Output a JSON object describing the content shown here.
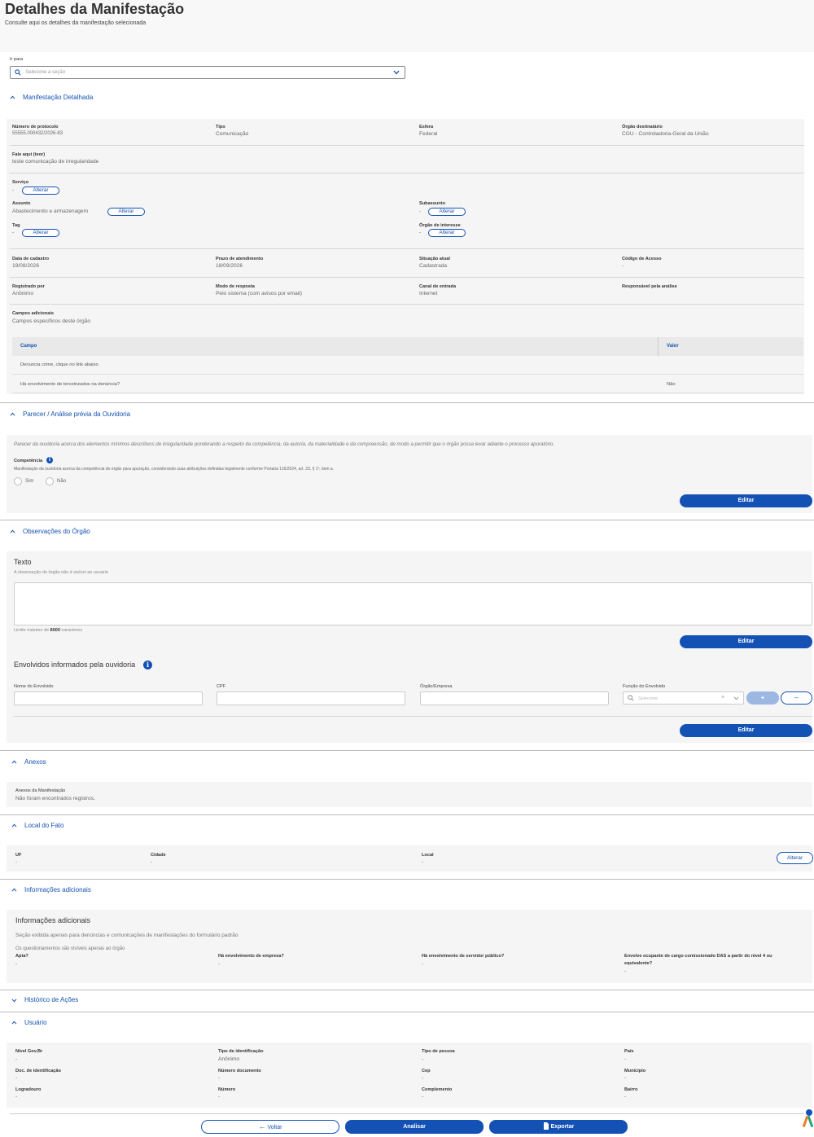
{
  "header": {
    "title": "Detalhes da Manifestação",
    "subtitle": "Consulte aqui os detalhes da manifestação selecionada"
  },
  "goto": {
    "label": "Ir para",
    "placeholder": "Selecione a seção"
  },
  "manifestacao": {
    "title": "Manifestação Detalhada",
    "protocolo": {
      "label": "Número de protocolo",
      "value": "55555.000432/2026-83"
    },
    "tipo": {
      "label": "Tipo",
      "value": "Comunicação"
    },
    "esfera": {
      "label": "Esfera",
      "value": "Federal"
    },
    "orgao_destinatario": {
      "label": "Órgão destinatário",
      "value": "CGU - Controladoria-Geral da União"
    },
    "teor": {
      "label": "Fale aqui (teor)",
      "value": "teste comunicação de irregularidade"
    },
    "servico": {
      "label": "Serviço",
      "value": "-"
    },
    "assunto": {
      "label": "Assunto",
      "value": "Abastecimento e armazenagem"
    },
    "subassunto": {
      "label": "Subassunto",
      "value": "-"
    },
    "tag": {
      "label": "Tag",
      "value": "-"
    },
    "orgao_interesse": {
      "label": "Órgão de interesse",
      "value": "-"
    },
    "alterar_label": "Alterar",
    "data_cadastro": {
      "label": "Data de cadastro",
      "value": "19/08/2026"
    },
    "prazo": {
      "label": "Prazo de atendimento",
      "value": "18/09/2026"
    },
    "situacao": {
      "label": "Situação atual",
      "value": "Cadastrada"
    },
    "codigo_acesso": {
      "label": "Código de Acesso",
      "value": "-"
    },
    "registrado_por": {
      "label": "Registrado por",
      "value": "Anônimo"
    },
    "modo_resposta": {
      "label": "Modo de resposta",
      "value": "Pelo sistema (com avisos por email)"
    },
    "canal_entrada": {
      "label": "Canal de entrada",
      "value": "Internet"
    },
    "responsavel": {
      "label": "Responsável pela análise"
    },
    "campos_adicionais": {
      "label": "Campos adicionais",
      "value": "Campos específicos deste órgão"
    },
    "table": {
      "headers": [
        "Campo",
        "Valor"
      ],
      "rows": [
        [
          "Denuncia crime, clique no link abaixo",
          ""
        ],
        [
          "Há envolvimento de terceirizados na denúncia?",
          "Não"
        ]
      ]
    }
  },
  "parecer": {
    "title": "Parecer / Análise prévia da Ouvidoria",
    "description": "Parecer da ouvidoria acerca dos elementos mínimos descritivos de irregularidade ponderando a respeito da competência, da autoria, da materialidade e da compreensão, de modo a permitir que o órgão possa levar adiante o processo apuratório.",
    "competencia_label": "Competência",
    "competencia_desc": "Manifestação da ouvidoria acerca da competência do órgão para apuração, considerando suas atribuições definidas legalmente conforme Portaria 116/2024, art. 33, § 1º, item a.",
    "sim": "Sim",
    "nao": "Não",
    "editar": "Editar"
  },
  "observacoes": {
    "title": "Observações do Órgão",
    "texto_label": "Texto",
    "texto_hint": "A observação do órgão não é visível ao usuário",
    "limite_prefix": "Limite máximo de ",
    "limite_value": "8000",
    "limite_suffix": " caracteres",
    "editar": "Editar",
    "envolvidos_title": "Envolvidos informados pela ouvidoria",
    "nome_label": "Nome do Envolvido",
    "cpf_label": "CPF",
    "orgao_label": "Órgão/Empresa",
    "funcao_label": "Função do Envolvido",
    "funcao_placeholder": "Selecione",
    "add_label": "+",
    "minus_label": "–",
    "editar2": "Editar"
  },
  "anexos": {
    "title": "Anexos",
    "label": "Anexos da Manifestação",
    "value": "Não foram encontrados registros."
  },
  "local": {
    "title": "Local do Fato",
    "uf": {
      "label": "UF",
      "value": "-"
    },
    "cidade": {
      "label": "Cidade",
      "value": "-"
    },
    "local": {
      "label": "Local",
      "value": "-"
    },
    "alterar": "Alterar"
  },
  "info": {
    "title": "Informações adicionais",
    "heading": "Informações adicionais",
    "desc": "Seção exibida apenas para denúncias e comunicações de manifestações do formulário padrão",
    "note": "Os questionamentos são visíveis apenas ao órgão",
    "apta": {
      "label": "Apta?",
      "value": "-"
    },
    "empresa": {
      "label": "Há envolvimento de empresa?",
      "value": "-"
    },
    "servidor": {
      "label": "Há envolvimento de servidor público?",
      "value": "-"
    },
    "das_line1": "Envolve ocupante de cargo comissionado DAS a partir do nível 4 ou",
    "das_line2": "equivalente?",
    "das_value": "-"
  },
  "historico": {
    "title": "Histórico de Ações"
  },
  "usuario": {
    "title": "Usuário",
    "nivel": {
      "label": "Nível Gov.Br",
      "value": "-"
    },
    "tipo_ident": {
      "label": "Tipo de identificação",
      "value": "Anônimo"
    },
    "tipo_pessoa": {
      "label": "Tipo de pessoa",
      "value": "-"
    },
    "pais": {
      "label": "País",
      "value": "-"
    },
    "doc": {
      "label": "Doc. de identificação",
      "value": "-"
    },
    "num_doc": {
      "label": "Número documento",
      "value": "-"
    },
    "cep": {
      "label": "Cep",
      "value": "-"
    },
    "municipio": {
      "label": "Município",
      "value": "-"
    },
    "logradouro": {
      "label": "Logradouro",
      "value": "-"
    },
    "numero": {
      "label": "Número",
      "value": "-"
    },
    "complemento": {
      "label": "Complemento",
      "value": "-"
    },
    "bairro": {
      "label": "Bairro",
      "value": "-"
    }
  },
  "footer": {
    "voltar": "Voltar",
    "analisar": "Analisar",
    "exportar": "Exportar"
  }
}
